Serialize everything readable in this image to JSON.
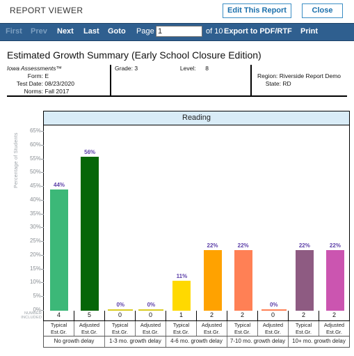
{
  "header": {
    "viewer_title": "REPORT VIEWER",
    "edit_button": "Edit This Report",
    "close_button": "Close"
  },
  "nav": {
    "first": "First",
    "prev": "Prev",
    "next": "Next",
    "last": "Last",
    "goto": "Goto",
    "page_label": "Page",
    "page_value": "1",
    "page_placeholder": "",
    "of_total": "of 10",
    "export": "Export to PDF/RTF",
    "print": "Print"
  },
  "report": {
    "title": "Estimated Growth Summary (Early School Closure Edition)",
    "brand": "Iowa Assessments™",
    "form_label": "Form:",
    "form_value": "E",
    "test_date_label": "Test Date:",
    "test_date_value": "08/23/2020",
    "norms_label": "Norms:",
    "norms_value": "Fall 2017",
    "grade_label": "Grade:",
    "grade_value": "3",
    "level_label": "Level:",
    "level_value": "8",
    "region_label": "Region:",
    "region_value": "Riverside Report Demo",
    "state_label": "State:",
    "state_value": "RD"
  },
  "chart_labels": {
    "plot_title": "Reading",
    "y_axis_caption": "Percentage of Students",
    "number_included_line1": "NUMBER",
    "number_included_line2": "INCLUDED"
  },
  "chart_data": {
    "type": "bar",
    "title": "Reading",
    "xlabel": "",
    "ylabel": "Percentage of Students",
    "ylim": [
      0,
      65
    ],
    "ytick_labels": [
      "0%",
      "5%",
      "10%",
      "15%",
      "20%",
      "25%",
      "30%",
      "35%",
      "40%",
      "45%",
      "50%",
      "55%",
      "60%",
      "65%"
    ],
    "ytick_values": [
      0,
      5,
      10,
      15,
      20,
      25,
      30,
      35,
      40,
      45,
      50,
      55,
      60,
      65
    ],
    "grid": false,
    "legend": "none",
    "categories": [
      "Typical Est.Gr.",
      "Adjusted Est.Gr.",
      "Typical Est.Gr.",
      "Adjusted Est.Gr.",
      "Typical Est.Gr.",
      "Adjusted Est.Gr.",
      "Typical Est.Gr.",
      "Adjusted Est.Gr.",
      "Typical Est.Gr.",
      "Adjusted Est.Gr."
    ],
    "values": [
      44,
      56,
      0,
      0,
      11,
      22,
      22,
      0,
      22,
      22
    ],
    "value_labels": [
      "44%",
      "56%",
      "0%",
      "0%",
      "11%",
      "22%",
      "22%",
      "0%",
      "22%",
      "22%"
    ],
    "counts": [
      "4",
      "5",
      "0",
      "0",
      "1",
      "2",
      "2",
      "0",
      "2",
      "2"
    ],
    "bar_colors": [
      "#3cb878",
      "#056608",
      "#d9cc22",
      "#d9cc22",
      "#ffd900",
      "#ffa200",
      "#ff8055",
      "#ff8055",
      "#8e5b82",
      "#cb55b0"
    ],
    "category_lines": [
      [
        "Typical",
        "Est.Gr."
      ],
      [
        "Adjusted",
        "Est.Gr."
      ],
      [
        "Typical",
        "Est.Gr."
      ],
      [
        "Adjusted",
        "Est.Gr."
      ],
      [
        "Typical",
        "Est.Gr."
      ],
      [
        "Adjusted",
        "Est.Gr."
      ],
      [
        "Typical",
        "Est.Gr."
      ],
      [
        "Adjusted",
        "Est.Gr."
      ],
      [
        "Typical",
        "Est.Gr."
      ],
      [
        "Adjusted",
        "Est.Gr."
      ]
    ],
    "groups": [
      {
        "label": "No growth delay",
        "span": 2
      },
      {
        "label": "1-3 mo. growth delay",
        "span": 2
      },
      {
        "label": "4-6 mo. growth delay",
        "span": 2
      },
      {
        "label": "7-10 mo. growth delay",
        "span": 2
      },
      {
        "label": "10+ mo. growth delay",
        "span": 2
      }
    ],
    "value_label_color": "#5b3ea8"
  }
}
